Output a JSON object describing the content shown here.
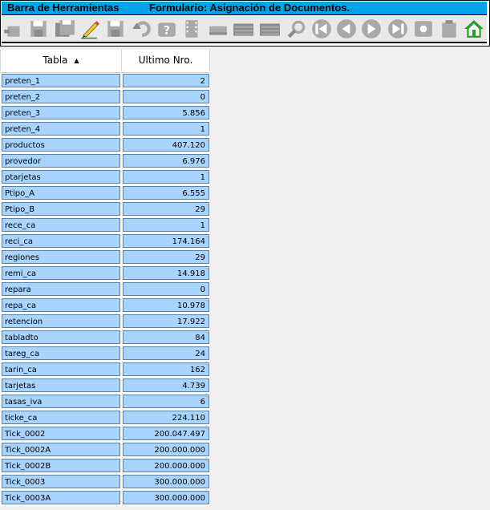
{
  "toolbar": {
    "title_left": "Barra de Herramientas",
    "title_right": "Formulario: Asignación de Documentos.",
    "buttons": [
      {
        "icon": "new-doc-icon",
        "enabled": false
      },
      {
        "icon": "save-disk-icon",
        "enabled": false
      },
      {
        "icon": "save-all-disk-icon",
        "enabled": false
      },
      {
        "icon": "edit-pencil-icon",
        "enabled": true
      },
      {
        "icon": "save-disk-icon",
        "enabled": false
      },
      {
        "icon": "undo-icon",
        "enabled": false
      },
      {
        "icon": "help-icon",
        "enabled": false
      },
      {
        "icon": "film-icon",
        "enabled": false
      },
      {
        "icon": "tray-icon",
        "enabled": false
      },
      {
        "icon": "list-icon",
        "enabled": false
      },
      {
        "icon": "list-icon",
        "enabled": false
      },
      {
        "icon": "search-icon",
        "enabled": false
      },
      {
        "icon": "first-record-icon",
        "enabled": false
      },
      {
        "icon": "previous-record-icon",
        "enabled": false
      },
      {
        "icon": "next-record-icon",
        "enabled": false
      },
      {
        "icon": "last-record-icon",
        "enabled": false
      },
      {
        "icon": "config-icon",
        "enabled": false
      },
      {
        "icon": "building-icon",
        "enabled": false
      },
      {
        "icon": "home-icon",
        "enabled": true
      }
    ]
  },
  "grid": {
    "columns": [
      "Tabla",
      "Ultimo Nro."
    ],
    "sort_column": "Tabla",
    "sort_direction": "ascending",
    "rows": [
      {
        "tabla": "preten_1",
        "ultimo": "2"
      },
      {
        "tabla": "preten_2",
        "ultimo": "0"
      },
      {
        "tabla": "preten_3",
        "ultimo": "5.856"
      },
      {
        "tabla": "preten_4",
        "ultimo": "1"
      },
      {
        "tabla": "productos",
        "ultimo": "407.120"
      },
      {
        "tabla": "provedor",
        "ultimo": "6.976"
      },
      {
        "tabla": "ptarjetas",
        "ultimo": "1"
      },
      {
        "tabla": "Ptipo_A",
        "ultimo": "6.555"
      },
      {
        "tabla": "Ptipo_B",
        "ultimo": "29"
      },
      {
        "tabla": "rece_ca",
        "ultimo": "1"
      },
      {
        "tabla": "reci_ca",
        "ultimo": "174.164"
      },
      {
        "tabla": "regiones",
        "ultimo": "29"
      },
      {
        "tabla": "remi_ca",
        "ultimo": "14.918"
      },
      {
        "tabla": "repara",
        "ultimo": "0"
      },
      {
        "tabla": "repa_ca",
        "ultimo": "10.978"
      },
      {
        "tabla": "retencion",
        "ultimo": "17.922"
      },
      {
        "tabla": "tabladto",
        "ultimo": "84"
      },
      {
        "tabla": "tareg_ca",
        "ultimo": "24"
      },
      {
        "tabla": "tarin_ca",
        "ultimo": "162"
      },
      {
        "tabla": "tarjetas",
        "ultimo": "4.739"
      },
      {
        "tabla": "tasas_iva",
        "ultimo": "6"
      },
      {
        "tabla": "ticke_ca",
        "ultimo": "224.110"
      },
      {
        "tabla": "Tick_0002",
        "ultimo": "200.047.497"
      },
      {
        "tabla": "Tick_0002A",
        "ultimo": "200.000.000"
      },
      {
        "tabla": "Tick_0002B",
        "ultimo": "200.000.000"
      },
      {
        "tabla": "Tick_0003",
        "ultimo": "300.000.000"
      },
      {
        "tabla": "Tick_0003A",
        "ultimo": "300.000.000"
      }
    ]
  },
  "colors": {
    "titlebar": "#00a2e8",
    "cell_background": "#a8d4ff",
    "cell_border": "#5f7f9f"
  }
}
